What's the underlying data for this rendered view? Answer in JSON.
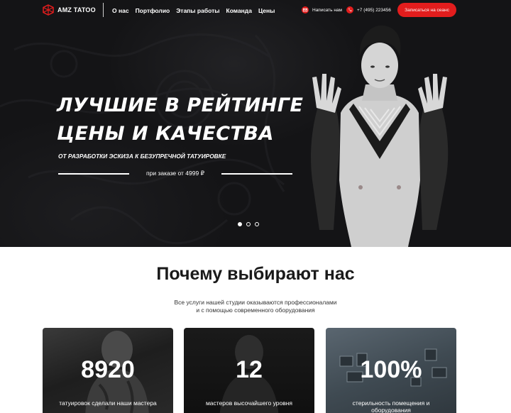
{
  "header": {
    "logo_text": "AMZ TATOO",
    "nav": [
      "О нас",
      "Портфолио",
      "Этапы работы",
      "Команда",
      "Цены"
    ],
    "write_us": "Написать нам",
    "phone": "+7 (495) 223456",
    "cta": "Записаться на сеанс",
    "accent_color": "#e31d1d"
  },
  "hero": {
    "title_line1": "ЛУЧШИЕ В РЕЙТИНГЕ",
    "title_line2": "ЦЕНЫ И КАЧЕСТВА",
    "subtitle": "ОТ РАЗРАБОТКИ ЭСКИЗА К БЕЗУПРЕЧНОЙ ТАТУИРОВКЕ",
    "price": "при заказе от 4999 ₽",
    "slides": 3,
    "active_slide": 1
  },
  "why": {
    "title": "Почему выбирают нас",
    "desc_line1": "Все услуги нашей студии оказываются профессионалами",
    "desc_line2": "и с помощью современного оборудования"
  },
  "stats": [
    {
      "value": "8920",
      "caption_line1": "татуировок сделали наши мастера",
      "caption_line2": ""
    },
    {
      "value": "12",
      "caption_line1": "мастеров высочайшего уровня",
      "caption_line2": ""
    },
    {
      "value": "100%",
      "caption_line1": "стерильность помещения и",
      "caption_line2": "оборудования"
    }
  ]
}
